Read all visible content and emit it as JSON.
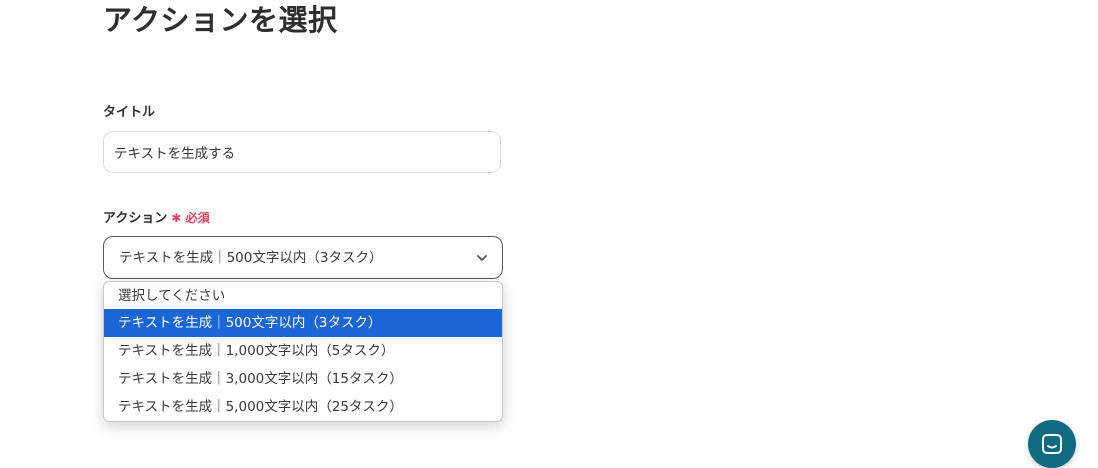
{
  "page": {
    "title": "アクションを選択"
  },
  "form": {
    "title_field": {
      "label": "タイトル",
      "value": "テキストを生成する"
    },
    "action_field": {
      "label": "アクション",
      "required_label": "✱ 必須",
      "selected_value": "テキストを生成｜500文字以内（3タスク）",
      "options": [
        "選択してください",
        "テキストを生成｜500文字以内（3タスク）",
        "テキストを生成｜1,000文字以内（5タスク）",
        "テキストを生成｜3,000文字以内（15タスク）",
        "テキストを生成｜5,000文字以内（25タスク）"
      ],
      "highlighted_index": 1
    }
  },
  "icons": {
    "select_chevron": "chevron-down-icon",
    "chat": "chat-icon"
  },
  "colors": {
    "highlight": "#1a66d6",
    "required": "#e2445c",
    "chat_button": "#0f6b82"
  }
}
